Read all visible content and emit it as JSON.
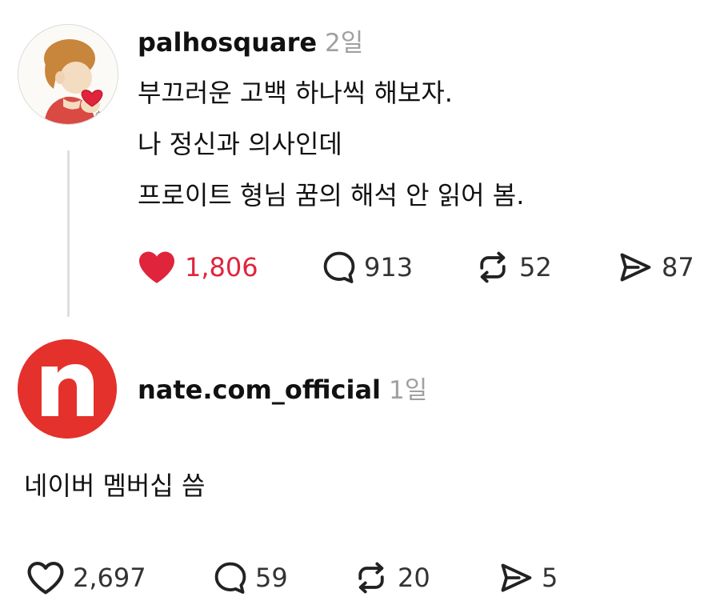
{
  "posts": [
    {
      "username": "palhosquare",
      "time": "2일",
      "lines": [
        "부끄러운 고백 하나씩 해보자.",
        "나 정신과 의사인데",
        "프로이트 형님 꿈의 해석 안 읽어 봄."
      ],
      "stats": {
        "likes": "1,806",
        "comments": "913",
        "reposts": "52",
        "shares": "87"
      },
      "liked": true
    },
    {
      "username": "nate.com_official",
      "time": "1일",
      "lines": [
        "네이버 멤버십 씀"
      ],
      "stats": {
        "likes": "2,697",
        "comments": "59",
        "reposts": "20",
        "shares": "5"
      },
      "liked": false,
      "avatar_letter": "n"
    }
  ],
  "colors": {
    "like_active": "#e0243b",
    "nate_brand": "#e4312c",
    "timestamp": "#a0a0a0"
  },
  "icons": [
    "heart-icon",
    "comment-icon",
    "repost-icon",
    "share-icon"
  ]
}
